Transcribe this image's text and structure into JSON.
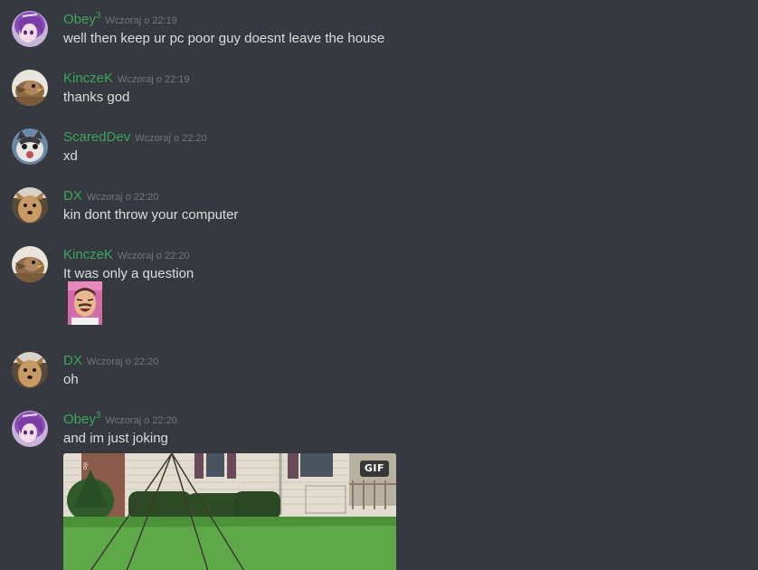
{
  "messages": [
    {
      "username": "Obey",
      "superscript": "3",
      "timestamp": "Wczoraj o 22:19",
      "text": "well then keep ur pc poor guy doesnt leave the house",
      "avatar": "purple-hair-anime-avatar"
    },
    {
      "username": "KinczeK",
      "superscript": "",
      "timestamp": "Wczoraj o 22:19",
      "text": "thanks god",
      "avatar": "bird-avatar"
    },
    {
      "username": "ScaredDev",
      "superscript": "",
      "timestamp": "Wczoraj o 22:20",
      "text": "xd",
      "avatar": "cat-avatar"
    },
    {
      "username": "DX",
      "superscript": "",
      "timestamp": "Wczoraj o 22:20",
      "text": "kin dont throw your computer",
      "avatar": "dog-avatar"
    },
    {
      "username": "KinczeK",
      "superscript": "",
      "timestamp": "Wczoraj o 22:20",
      "text": "It was only a question",
      "avatar": "bird-avatar",
      "attachment": "laughing-man-emoji"
    },
    {
      "username": "DX",
      "superscript": "",
      "timestamp": "Wczoraj o 22:20",
      "text": "oh",
      "avatar": "dog-avatar"
    },
    {
      "username": "Obey",
      "superscript": "3",
      "timestamp": "Wczoraj o 22:20",
      "text": "and im just joking",
      "avatar": "purple-hair-anime-avatar",
      "attachment": "gif-embed",
      "gif_badge": "GIF"
    }
  ],
  "colors": {
    "background": "#36393f",
    "username": "#3ba55c",
    "timestamp": "#72767d",
    "text": "#dcddde"
  }
}
